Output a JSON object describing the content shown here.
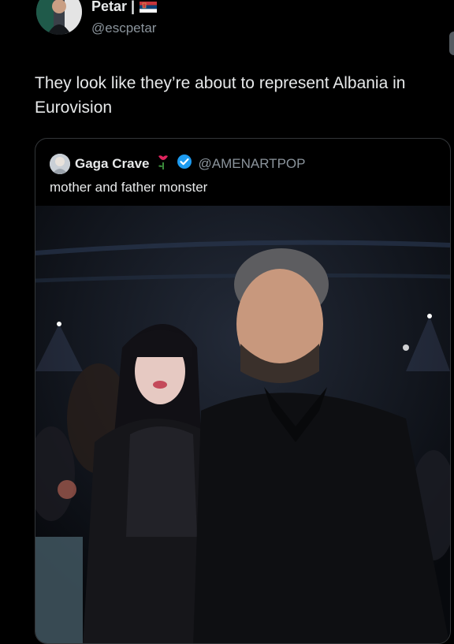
{
  "tweet": {
    "author_name": "Petar |",
    "author_handle": "@escpetar",
    "flag_icon": "serbia-flag-icon",
    "text": "They look like they’re about to represent Albania in Eurovision"
  },
  "quoted_tweet": {
    "author_name": "Gaga Crave",
    "badge_icon": "rose-emoji-icon",
    "verified_icon": "verified-badge-icon",
    "author_handle": "@AMENARTPOP",
    "text": "mother and father monster",
    "media": "photo"
  },
  "colors": {
    "background": "#000000",
    "text_primary": "#e7e9ea",
    "text_secondary": "#8b949c",
    "border": "#333639",
    "verified": "#1d9bf0"
  }
}
